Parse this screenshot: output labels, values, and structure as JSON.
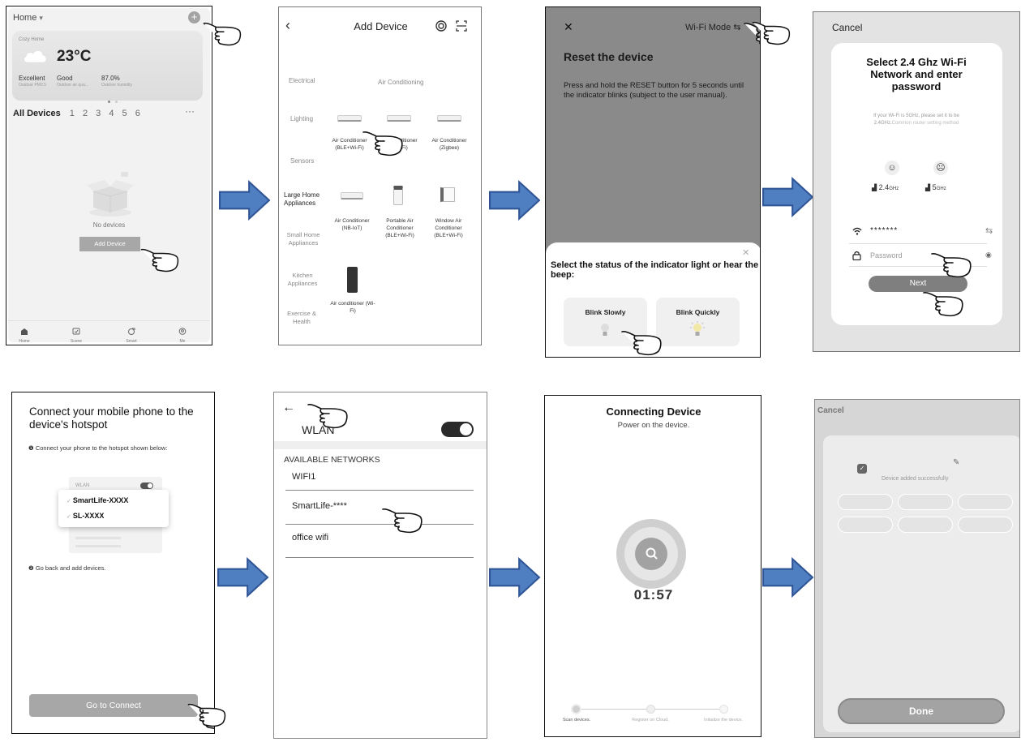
{
  "screen1": {
    "home_label": "Home",
    "home_caret": "▾",
    "home_subtitle": "Cozy Home",
    "temperature": "23°C",
    "stats": [
      {
        "value": "Excellent",
        "label": "Outdoor PM2.5"
      },
      {
        "value": "Good",
        "label": "Outdoor air qua..."
      },
      {
        "value": "87.0%",
        "label": "Outdoor humidity"
      }
    ],
    "tabs": [
      "All Devices",
      "1",
      "2",
      "3",
      "4",
      "5",
      "6"
    ],
    "more": "···",
    "empty_text": "No devices",
    "add_device_button": "Add Device",
    "bottom_nav": [
      {
        "label": "Home",
        "icon": "home-icon"
      },
      {
        "label": "Scene",
        "icon": "scene-icon"
      },
      {
        "label": "Smart",
        "icon": "smart-icon"
      },
      {
        "label": "Me",
        "icon": "me-icon"
      }
    ]
  },
  "screen2": {
    "back": "‹",
    "title": "Add Device",
    "categories": [
      "Electrical",
      "Lighting",
      "Sensors",
      "Large Home Appliances",
      "Small Home Appliances",
      "Kitchen Appliances",
      "Exercise & Health"
    ],
    "section_title": "Air Conditioning",
    "devices_row1": [
      "Air Conditioner (BLE+Wi-Fi)",
      "Air Conditioner (Wi-Fi)",
      "Air Conditioner (Zigbee)"
    ],
    "devices_row2": [
      "Air Conditioner (NB-IoT)",
      "Portable Air Conditioner (BLE+Wi-Fi)",
      "Window Air Conditioner (BLE+Wi-Fi)"
    ],
    "devices_row3": [
      "Air conditioner (Wi-Fi)"
    ]
  },
  "screen3": {
    "close": "✕",
    "mode": "Wi-Fi Mode ⇆",
    "title": "Reset the device",
    "instructions": "Press and hold the RESET button for 5 seconds until the indicator blinks (subject to the user manual).",
    "sheet_close": "✕",
    "sheet_title": "Select the status of the indicator light or hear the beep:",
    "options": [
      "Blink Slowly",
      "Blink Quickly"
    ]
  },
  "screen4": {
    "cancel": "Cancel",
    "title": "Select 2.4 Ghz Wi-Fi Network and enter password",
    "note_prefix": "If your Wi-Fi is 5GHz, please set it to be 2.4GHz.",
    "note_link": "Common router setting method",
    "band_good": "2.4",
    "band_bad": "5",
    "band_unit": "GHz",
    "ssid_value": "*******",
    "password_placeholder": "Password",
    "next_button": "Next"
  },
  "screen5": {
    "title": "Connect your mobile phone to the device's hotspot",
    "step1": "Connect your phone to the hotspot shown below:",
    "wlan_label": "WLAN",
    "networks": [
      "SmartLife-XXXX",
      "SL-XXXX"
    ],
    "step2": "Go back and add devices.",
    "go_button": "Go to Connect"
  },
  "screen6": {
    "back": "←",
    "wlan_label": "WLAN",
    "section_header": "AVAILABLE NETWORKS",
    "networks": [
      "WIFI1",
      "SmartLife-****",
      "office wifi"
    ]
  },
  "screen7": {
    "title": "Connecting Device",
    "subtitle": "Power on the device.",
    "timer": "01:57",
    "steps": [
      "Scan devices.",
      "Register on Cloud.",
      "Initialize the device."
    ]
  },
  "screen8": {
    "cancel": "Cancel",
    "success_text": "Device added successfully",
    "done_button": "Done"
  },
  "colors": {
    "arrow_fill": "#4f7ec1",
    "arrow_stroke": "#2f5597",
    "gray_button": "#a7a7a7",
    "dim_overlay": "#8a8a8a"
  }
}
